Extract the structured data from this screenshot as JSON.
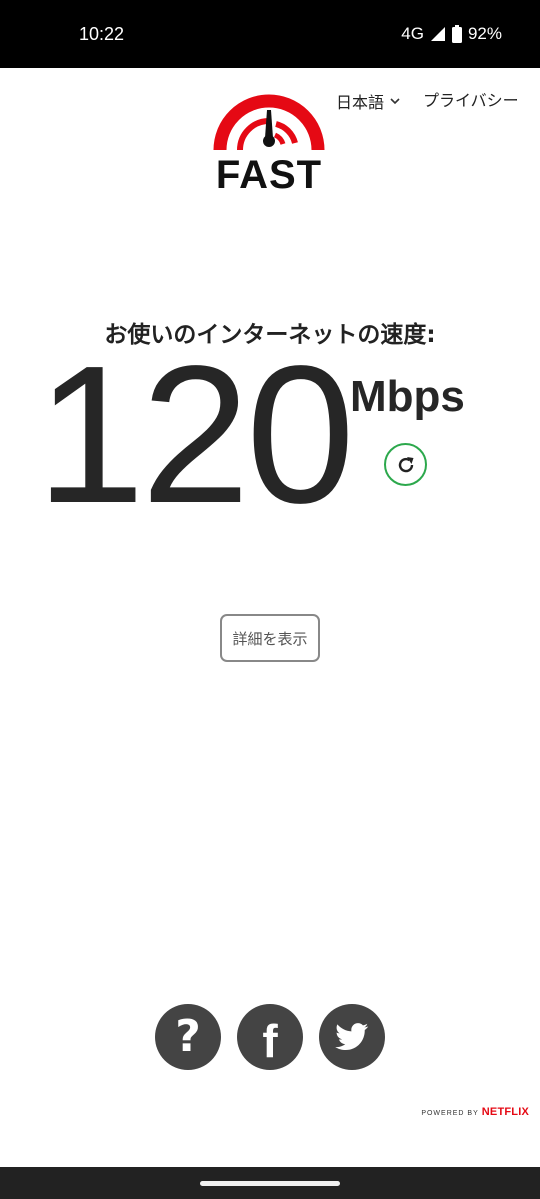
{
  "status_bar": {
    "time": "10:22",
    "network": "4G",
    "battery": "92%"
  },
  "header": {
    "logo_text": "FAST",
    "language": "日本語",
    "privacy": "プライバシー"
  },
  "main": {
    "speed_label": "お使いのインターネットの速度:",
    "speed_value": "120",
    "speed_unit": "Mbps",
    "details_button": "詳細を表示"
  },
  "footer": {
    "help_glyph": "?",
    "facebook_glyph": "f",
    "powered_by": "POWERED BY",
    "brand": "NETFLIX"
  },
  "colors": {
    "accent_red": "#e50914",
    "refresh_green": "#2ca84c",
    "social_gray": "#444444"
  },
  "icons": [
    "signal-icon",
    "battery-icon",
    "chevron-down-icon",
    "refresh-icon",
    "question-icon",
    "facebook-icon",
    "twitter-icon"
  ]
}
